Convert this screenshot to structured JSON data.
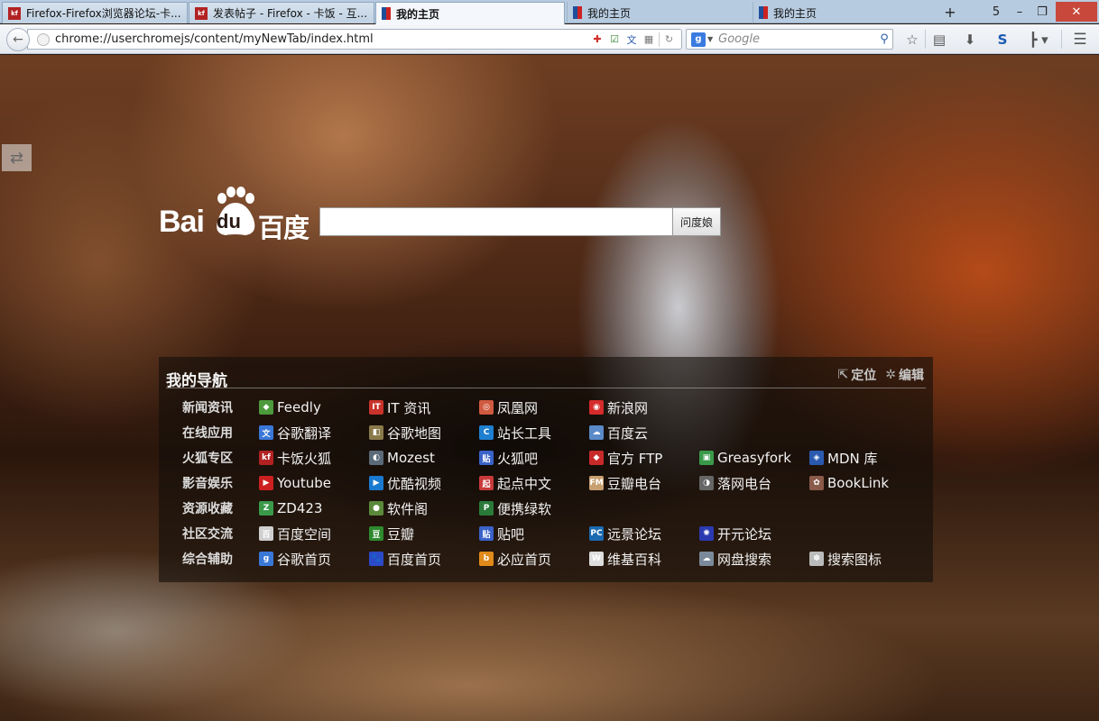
{
  "tabs": [
    {
      "title": "Firefox-Firefox浏览器论坛-卡...",
      "icon": "kafan-icon",
      "icon_text": "kf"
    },
    {
      "title": "发表帖子 - Firefox - 卡饭 - 互...",
      "icon": "kafan-icon",
      "icon_text": "kf"
    },
    {
      "title": "我的主页",
      "icon": "home-tab-icon",
      "icon_text": ""
    },
    {
      "title": "我的主页",
      "icon": "home-tab-icon",
      "icon_text": ""
    },
    {
      "title": "我的主页",
      "icon": "home-tab-icon",
      "icon_text": ""
    }
  ],
  "tab_count": "5",
  "window_controls": {
    "new_tab": "+",
    "minimize": "–",
    "restore": "❐",
    "close": "✕"
  },
  "navbar": {
    "url": "chrome://userchromejs/content/myNewTab/index.html",
    "search_engine_letter": "g",
    "search_placeholder": "Google"
  },
  "baidu": {
    "logo_bai": "Bai",
    "logo_du": "du",
    "logo_cn": "百度",
    "button_label": "问度娘"
  },
  "panel": {
    "title": "我的导航",
    "locate_label": "定位",
    "edit_label": "编辑",
    "rows": [
      {
        "category": "新闻资讯",
        "links": [
          {
            "label": "Feedly",
            "icon": "feedly-icon",
            "color": "#4c9a3c",
            "glyph": "◆"
          },
          {
            "label": "IT 资讯",
            "icon": "it-news-icon",
            "color": "#c8332b",
            "glyph": "IT"
          },
          {
            "label": "凤凰网",
            "icon": "ifeng-icon",
            "color": "#d05a40",
            "glyph": "◎"
          },
          {
            "label": "新浪网",
            "icon": "sina-icon",
            "color": "#d62b2b",
            "glyph": "◉"
          }
        ]
      },
      {
        "category": "在线应用",
        "links": [
          {
            "label": "谷歌翻译",
            "icon": "google-translate-icon",
            "color": "#3a78d8",
            "glyph": "文"
          },
          {
            "label": "谷歌地图",
            "icon": "google-maps-icon",
            "color": "#8a7a4a",
            "glyph": "◧"
          },
          {
            "label": "站长工具",
            "icon": "webmaster-tools-icon",
            "color": "#1f7fd0",
            "glyph": "C"
          },
          {
            "label": "百度云",
            "icon": "baidu-cloud-icon",
            "color": "#5a8ac8",
            "glyph": "☁"
          }
        ]
      },
      {
        "category": "火狐专区",
        "links": [
          {
            "label": "卡饭火狐",
            "icon": "kafan-firefox-icon",
            "color": "#b22222",
            "glyph": "kf"
          },
          {
            "label": "Mozest",
            "icon": "mozest-icon",
            "color": "#5a6a78",
            "glyph": "◐"
          },
          {
            "label": "火狐吧",
            "icon": "tieba-firefox-icon",
            "color": "#3a62c8",
            "glyph": "贴"
          },
          {
            "label": "官方 FTP",
            "icon": "ftp-icon",
            "color": "#c82a2a",
            "glyph": "◆"
          },
          {
            "label": "Greasyfork",
            "icon": "greasyfork-icon",
            "color": "#3a9a4a",
            "glyph": "▣"
          },
          {
            "label": "MDN 库",
            "icon": "mdn-icon",
            "color": "#2a5ab0",
            "glyph": "◈"
          }
        ]
      },
      {
        "category": "影音娱乐",
        "links": [
          {
            "label": "Youtube",
            "icon": "youtube-icon",
            "color": "#cc2020",
            "glyph": "▶"
          },
          {
            "label": "优酷视频",
            "icon": "youku-icon",
            "color": "#1a7ad0",
            "glyph": "▶"
          },
          {
            "label": "起点中文",
            "icon": "qidian-icon",
            "color": "#c83a3a",
            "glyph": "起"
          },
          {
            "label": "豆瓣电台",
            "icon": "douban-fm-icon",
            "color": "#c8a070",
            "glyph": "FM"
          },
          {
            "label": "落网电台",
            "icon": "luoo-icon",
            "color": "#666666",
            "glyph": "◑"
          },
          {
            "label": "BookLink",
            "icon": "booklink-icon",
            "color": "#8a5a4a",
            "glyph": "✿"
          }
        ]
      },
      {
        "category": "资源收藏",
        "links": [
          {
            "label": "ZD423",
            "icon": "zd423-icon",
            "color": "#3a9a4a",
            "glyph": "Z"
          },
          {
            "label": "软件阁",
            "icon": "ruanjiange-icon",
            "color": "#5a8a3a",
            "glyph": "●"
          },
          {
            "label": "便携绿软",
            "icon": "portable-soft-icon",
            "color": "#2a7a3a",
            "glyph": "P"
          }
        ]
      },
      {
        "category": "社区交流",
        "links": [
          {
            "label": "百度空间",
            "icon": "baidu-space-icon",
            "color": "#cfcfcf",
            "glyph": "百"
          },
          {
            "label": "豆瓣",
            "icon": "douban-icon",
            "color": "#2e8a2e",
            "glyph": "豆"
          },
          {
            "label": "贴吧",
            "icon": "tieba-icon",
            "color": "#3a62c8",
            "glyph": "贴"
          },
          {
            "label": "远景论坛",
            "icon": "pcbeta-icon",
            "color": "#1a6ab0",
            "glyph": "PC"
          },
          {
            "label": "开元论坛",
            "icon": "kaiyuan-icon",
            "color": "#2a3ab0",
            "glyph": "✺"
          }
        ]
      },
      {
        "category": "综合辅助",
        "links": [
          {
            "label": "谷歌首页",
            "icon": "google-home-icon",
            "color": "#3a78d8",
            "glyph": "g"
          },
          {
            "label": "百度首页",
            "icon": "baidu-home-icon",
            "color": "#2a4ac8",
            "glyph": "🐾"
          },
          {
            "label": "必应首页",
            "icon": "bing-icon",
            "color": "#e08a1a",
            "glyph": "b"
          },
          {
            "label": "维基百科",
            "icon": "wikipedia-icon",
            "color": "#dddddd",
            "glyph": "W"
          },
          {
            "label": "网盘搜索",
            "icon": "pan-search-icon",
            "color": "#7a8a9a",
            "glyph": "☁"
          },
          {
            "label": "搜索图标",
            "icon": "icon-search-icon",
            "color": "#bbbbbb",
            "glyph": "✽"
          }
        ]
      }
    ]
  }
}
